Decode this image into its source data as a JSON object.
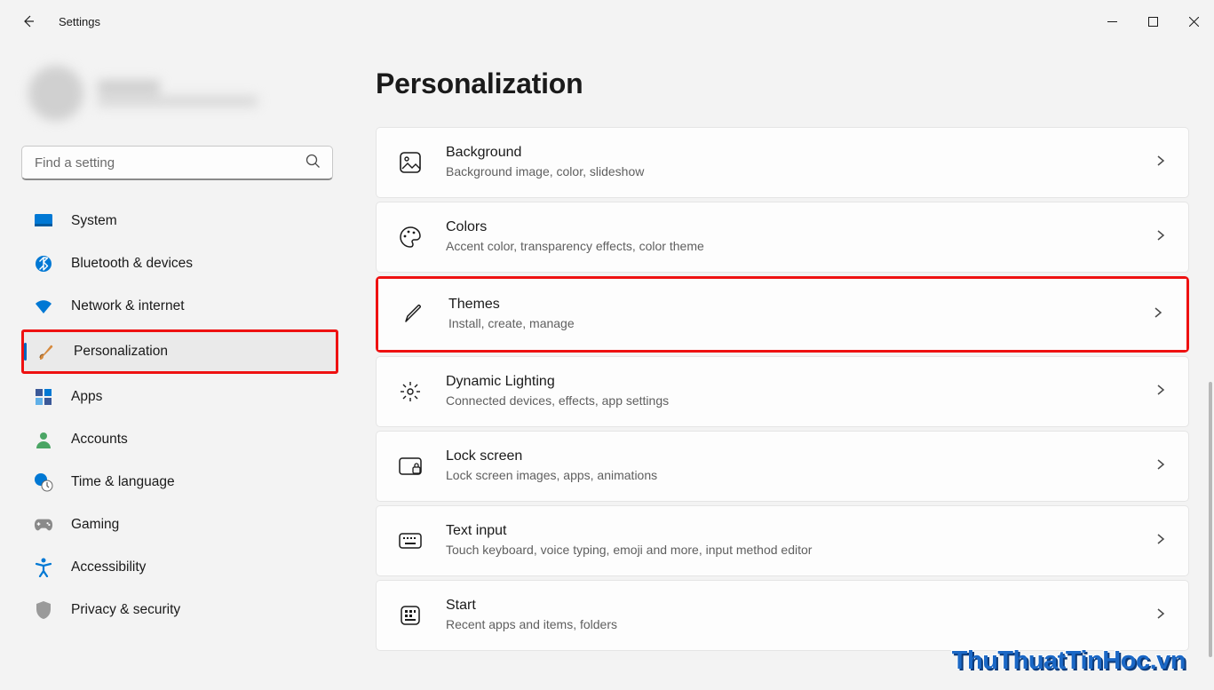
{
  "app_title": "Settings",
  "search": {
    "placeholder": "Find a setting"
  },
  "sidebar": {
    "items": [
      {
        "id": "system",
        "label": "System"
      },
      {
        "id": "bluetooth",
        "label": "Bluetooth & devices"
      },
      {
        "id": "network",
        "label": "Network & internet"
      },
      {
        "id": "personalization",
        "label": "Personalization"
      },
      {
        "id": "apps",
        "label": "Apps"
      },
      {
        "id": "accounts",
        "label": "Accounts"
      },
      {
        "id": "time",
        "label": "Time & language"
      },
      {
        "id": "gaming",
        "label": "Gaming"
      },
      {
        "id": "accessibility",
        "label": "Accessibility"
      },
      {
        "id": "privacy",
        "label": "Privacy & security"
      }
    ]
  },
  "page": {
    "title": "Personalization",
    "cards": [
      {
        "id": "background",
        "title": "Background",
        "desc": "Background image, color, slideshow"
      },
      {
        "id": "colors",
        "title": "Colors",
        "desc": "Accent color, transparency effects, color theme"
      },
      {
        "id": "themes",
        "title": "Themes",
        "desc": "Install, create, manage"
      },
      {
        "id": "dynamic-lighting",
        "title": "Dynamic Lighting",
        "desc": "Connected devices, effects, app settings"
      },
      {
        "id": "lock-screen",
        "title": "Lock screen",
        "desc": "Lock screen images, apps, animations"
      },
      {
        "id": "text-input",
        "title": "Text input",
        "desc": "Touch keyboard, voice typing, emoji and more, input method editor"
      },
      {
        "id": "start",
        "title": "Start",
        "desc": "Recent apps and items, folders"
      }
    ]
  },
  "watermark": "ThuThuatTinHoc.vn"
}
